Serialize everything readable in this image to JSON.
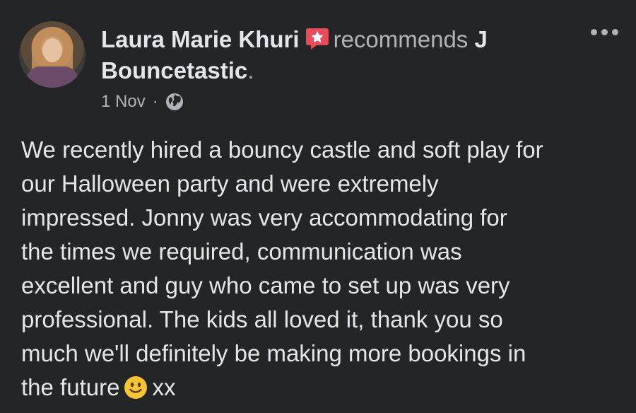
{
  "post": {
    "author": "Laura Marie Khuri",
    "recommends_text": "recommends",
    "page_name_part1": "J",
    "page_name_part2": "Bouncetastic",
    "page_name_suffix": ".",
    "date": "1 Nov",
    "separator": "·",
    "privacy_icon": "globe-icon",
    "badge_icon": "recommend-star-badge-icon",
    "body_lines": [
      "We recently hired a bouncy castle and soft play for",
      "our Halloween party and were extremely",
      "impressed. Jonny was very accommodating for",
      "the times we required, communication was",
      "excellent and guy who came to set up was very",
      "professional. The kids all loved it, thank you so",
      "much  we'll definitely be making more bookings in",
      "the future"
    ],
    "body_end": "xx",
    "emoji": "slightly-smiling-face-emoji",
    "colors": {
      "background": "#242526",
      "primary_text": "#e4e6eb",
      "secondary_text": "#b0b3b8",
      "badge": "#e84c5a"
    }
  }
}
